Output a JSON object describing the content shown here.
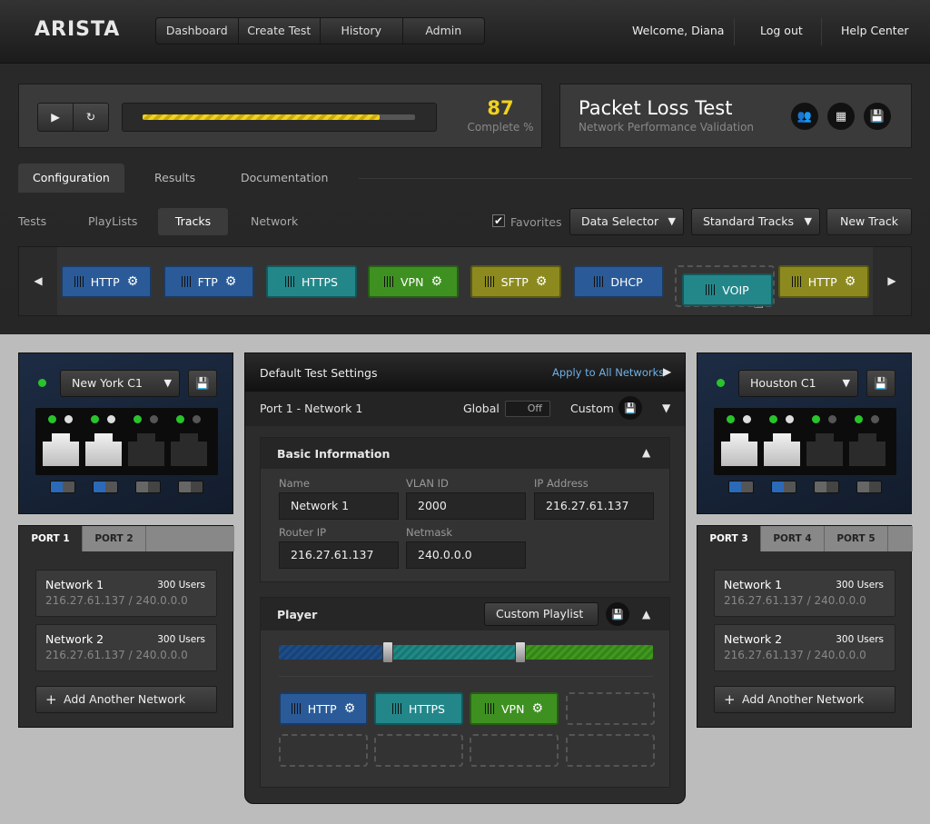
{
  "brand": {
    "logo": "ARISTA"
  },
  "nav": {
    "items": [
      "Dashboard",
      "Create Test",
      "History",
      "Admin"
    ]
  },
  "user": {
    "welcome": "Welcome, Diana",
    "logout": "Log out",
    "help": "Help Center"
  },
  "progress": {
    "value": "87",
    "label": "Complete %",
    "fraction": 0.87
  },
  "test": {
    "title": "Packet Loss Test",
    "subtitle": "Network Performance Validation"
  },
  "tabs": [
    "Configuration",
    "Results",
    "Documentation"
  ],
  "subtabs": [
    "Tests",
    "PlayLists",
    "Tracks",
    "Network"
  ],
  "toolbar": {
    "favorites": "Favorites",
    "data_selector": "Data Selector",
    "standard_tracks": "Standard Tracks",
    "new_track": "New Track"
  },
  "tracks": [
    {
      "label": "HTTP",
      "color": "blue",
      "gear": true
    },
    {
      "label": "FTP",
      "color": "blue",
      "gear": true
    },
    {
      "label": "HTTPS",
      "color": "teal",
      "gear": false
    },
    {
      "label": "VPN",
      "color": "green",
      "gear": true
    },
    {
      "label": "SFTP",
      "color": "olive",
      "gear": true
    },
    {
      "label": "DHCP",
      "color": "blue",
      "gear": false
    },
    {
      "label": "VOIP",
      "color": "teal",
      "gear": false
    },
    {
      "label": "HTTP",
      "color": "olive",
      "gear": true
    }
  ],
  "left_switch": {
    "location": "New York C1",
    "ports": [
      "PORT 1",
      "PORT 2"
    ],
    "networks": [
      {
        "name": "Network 1",
        "users": "300 Users",
        "ip": "216.27.61.137 / 240.0.0.0"
      },
      {
        "name": "Network 2",
        "users": "300 Users",
        "ip": "216.27.61.137 / 240.0.0.0"
      }
    ],
    "add": "Add Another Network"
  },
  "right_switch": {
    "location": "Houston C1",
    "ports": [
      "PORT 3",
      "PORT 4",
      "PORT 5"
    ],
    "networks": [
      {
        "name": "Network 1",
        "users": "300 Users",
        "ip": "216.27.61.137 / 240.0.0.0"
      },
      {
        "name": "Network 2",
        "users": "300 Users",
        "ip": "216.27.61.137 / 240.0.0.0"
      }
    ],
    "add": "Add Another Network"
  },
  "settings": {
    "title": "Default Test Settings",
    "apply": "Apply to All Networks",
    "port": "Port 1 - Network 1",
    "global": "Global",
    "toggle": "Off",
    "custom": "Custom",
    "basic": "Basic Information",
    "labels": {
      "name": "Name",
      "vlan": "VLAN ID",
      "ip": "IP Address",
      "router": "Router IP",
      "netmask": "Netmask"
    },
    "values": {
      "name": "Network 1",
      "vlan": "2000",
      "ip": "216.27.61.137",
      "router": "216.27.61.137",
      "netmask": "240.0.0.0"
    },
    "player": "Player",
    "playlist": "Custom Playlist",
    "player_tracks": [
      {
        "label": "HTTP",
        "color": "blue",
        "gear": true
      },
      {
        "label": "HTTPS",
        "color": "teal",
        "gear": false
      },
      {
        "label": "VPN",
        "color": "green",
        "gear": true
      }
    ]
  },
  "colors": {
    "blue": "#2a5b98",
    "teal": "#23878a",
    "green": "#3e9121",
    "olive": "#8c8a1f",
    "progress": "#f2d21b"
  }
}
